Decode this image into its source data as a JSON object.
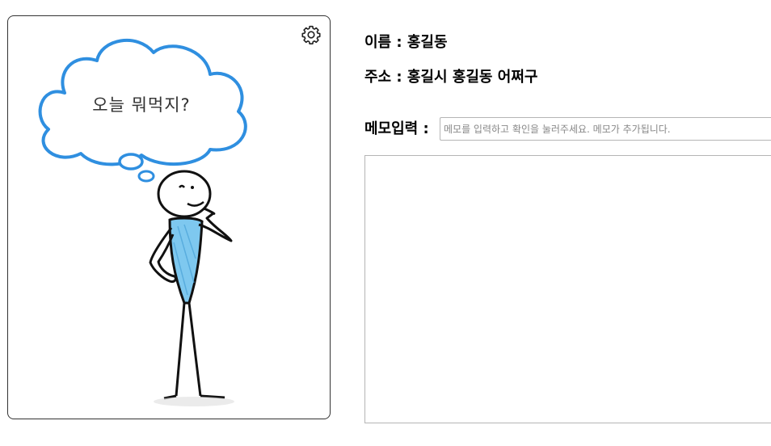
{
  "profile": {
    "thought_bubble_text": "오늘 뭐먹지?",
    "settings_icon": "gear-icon",
    "accent_color": "#2f8fe0",
    "shirt_color": "#7ec8ef"
  },
  "info": {
    "name_label": "이름",
    "name_value": "홍길동",
    "address_label": "주소",
    "address_value": "홍길시 홍길동 어쩌구"
  },
  "memo": {
    "label": "메모입력",
    "placeholder": "메모를 입력하고 확인을 눌러주세요. 메모가 추가됩니다.",
    "value": "",
    "items": []
  }
}
